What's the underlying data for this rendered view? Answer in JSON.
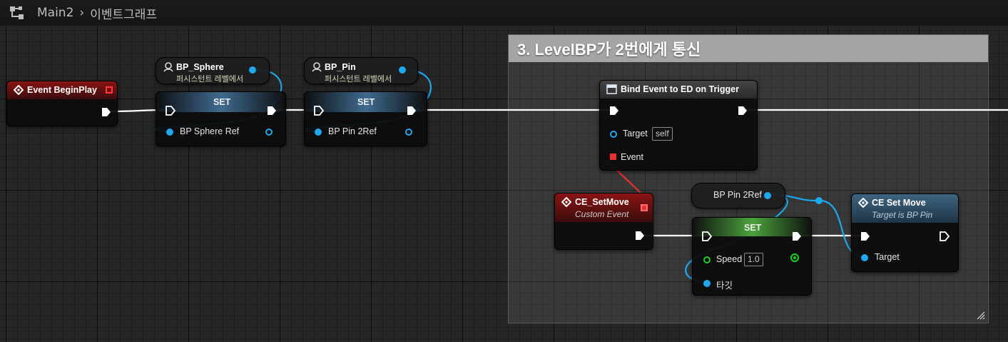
{
  "breadcrumb": {
    "root": "Main2",
    "separator": "›",
    "graph": "이벤트그래프"
  },
  "comment": {
    "title": "3. LevelBP가 2번에게 통신"
  },
  "nodes": {
    "begin_play": {
      "title": "Event BeginPlay"
    },
    "bp_sphere_get": {
      "title": "BP_Sphere",
      "subtitle": "퍼시스턴트 레벨에서"
    },
    "set_sphere": {
      "title": "SET",
      "pin": "BP Sphere Ref"
    },
    "bp_pin_get": {
      "title": "BP_Pin",
      "subtitle": "퍼시스턴트 레벨에서"
    },
    "set_pin": {
      "title": "SET",
      "pin": "BP Pin 2Ref"
    },
    "bind_event": {
      "title": "Bind Event to ED on Trigger",
      "target_label": "Target",
      "target_value": "self",
      "event_label": "Event"
    },
    "ce_setmove_event": {
      "title": "CE_SetMove",
      "subtitle": "Custom Event"
    },
    "bp_pin2ref_var": {
      "label": "BP Pin 2Ref"
    },
    "set_speed": {
      "title": "SET",
      "speed_label": "Speed",
      "speed_value": "1.0",
      "target_label": "타깃"
    },
    "ce_set_move_call": {
      "title": "CE Set Move",
      "subtitle": "Target is BP Pin",
      "target_label": "Target"
    }
  },
  "colors": {
    "exec": "#ffffff",
    "object_pin": "#1ea8ee",
    "float_pin": "#19d11d",
    "delegate_pin": "#e53131",
    "event_header": "#8a1414",
    "function_header": "#3f6581"
  },
  "icons": [
    "blueprint-icon",
    "event-diamond-icon",
    "level-actor-icon",
    "function-icon",
    "resize-grip-icon"
  ]
}
